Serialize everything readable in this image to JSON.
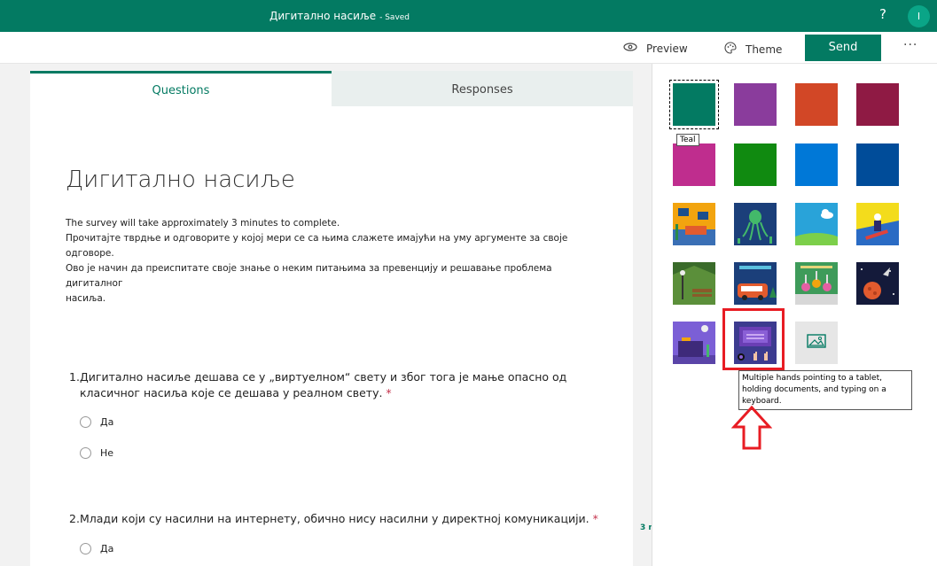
{
  "header": {
    "form_title": "Дигитално насиље",
    "saved_status": "- Saved",
    "help": "?",
    "avatar_initial": "I"
  },
  "commands": {
    "preview": "Preview",
    "theme": "Theme",
    "send": "Send",
    "more": "···"
  },
  "tabs": {
    "questions": "Questions",
    "responses": "Responses"
  },
  "form": {
    "title": "Дигитално насиље",
    "description": [
      "The survey will take approximately 3 minutes to complete.",
      "Прочитајте тврдње и одговорите у којој мери се са њима слажете имајући на уму аргументе за своје",
      "одговоре.",
      "Ово је начин да преиспитате своје знање о неким питањима за превенцију и решавање проблема",
      "дигиталног",
      "насиља."
    ],
    "questions": [
      {
        "number": "1.",
        "text": "Дигитално насиље дешава се у „виртуелном“ свету и због тога је мање опасно од класичног насиља које се дешава у реалном свету.",
        "required": "*",
        "options": [
          "Да",
          "Не"
        ]
      },
      {
        "number": "2.",
        "text": "Млади који су насилни на интернету, обично нису насилни у директној комуникацији.",
        "required": "*",
        "options": [
          "Да"
        ]
      }
    ],
    "side_badge": "3 r"
  },
  "theme_panel": {
    "colors": {
      "teal": "#037a62",
      "purple": "#8a3c9c",
      "orange": "#d24726",
      "maroon": "#8f1a44",
      "magenta": "#bf2d8e",
      "green": "#108a10",
      "blue": "#0078d7",
      "navy": "#004c99"
    },
    "selected_tooltip": "Teal",
    "hover_tooltip": "Multiple hands pointing to a tablet, holding documents, and typing on a keyboard.",
    "upload_icon": "image-upload-icon"
  },
  "annotation": {
    "highlight_color": "#e81c23"
  }
}
